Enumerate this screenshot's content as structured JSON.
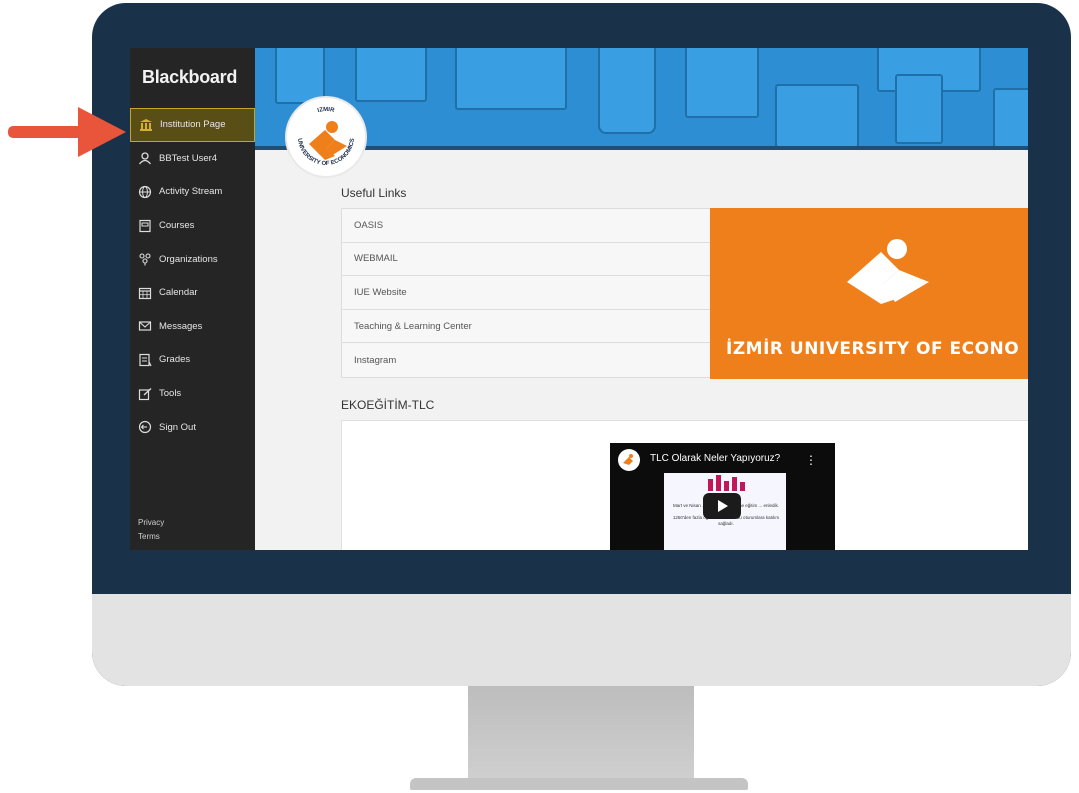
{
  "colors": {
    "bezel": "#1a3249",
    "sidebar": "#252525",
    "active_item": "#5a4e17",
    "banner": "#2d8ed4",
    "brand_orange": "#ee7f1a",
    "arrow": "#e8553a"
  },
  "sidebar": {
    "logo": "Blackboard",
    "items": [
      {
        "label": "Institution Page",
        "icon": "institution-icon",
        "active": true
      },
      {
        "label": "BBTest User4",
        "icon": "user-icon"
      },
      {
        "label": "Activity Stream",
        "icon": "globe-icon"
      },
      {
        "label": "Courses",
        "icon": "courses-icon"
      },
      {
        "label": "Organizations",
        "icon": "organizations-icon"
      },
      {
        "label": "Calendar",
        "icon": "calendar-icon"
      },
      {
        "label": "Messages",
        "icon": "envelope-icon"
      },
      {
        "label": "Grades",
        "icon": "grades-icon"
      },
      {
        "label": "Tools",
        "icon": "tools-icon"
      },
      {
        "label": "Sign Out",
        "icon": "sign-out-icon"
      }
    ],
    "footer": {
      "privacy": "Privacy",
      "terms": "Terms"
    }
  },
  "banner": {
    "seal_top": "IZMIR",
    "seal_bottom": "UNIVERSITY OF ECONOMICS"
  },
  "useful_links": {
    "title": "Useful Links",
    "links": [
      "OASIS",
      "WEBMAIL",
      "IUE Website",
      "Teaching & Learning Center",
      "Instagram"
    ],
    "brand_text": "İZMİR UNIVERSITY OF ECONO"
  },
  "ekoegitim": {
    "title": "EKOEĞİTİM-TLC",
    "video_title": "TLC Olarak Neler Yapıyoruz?",
    "video_caption_1": "Mart ve Nisan ... nde 27 tane online eğitim ... enledik.",
    "video_caption_2": "1250'den fazla öğretim elemanı bu oturumlara katılım sağladı."
  }
}
